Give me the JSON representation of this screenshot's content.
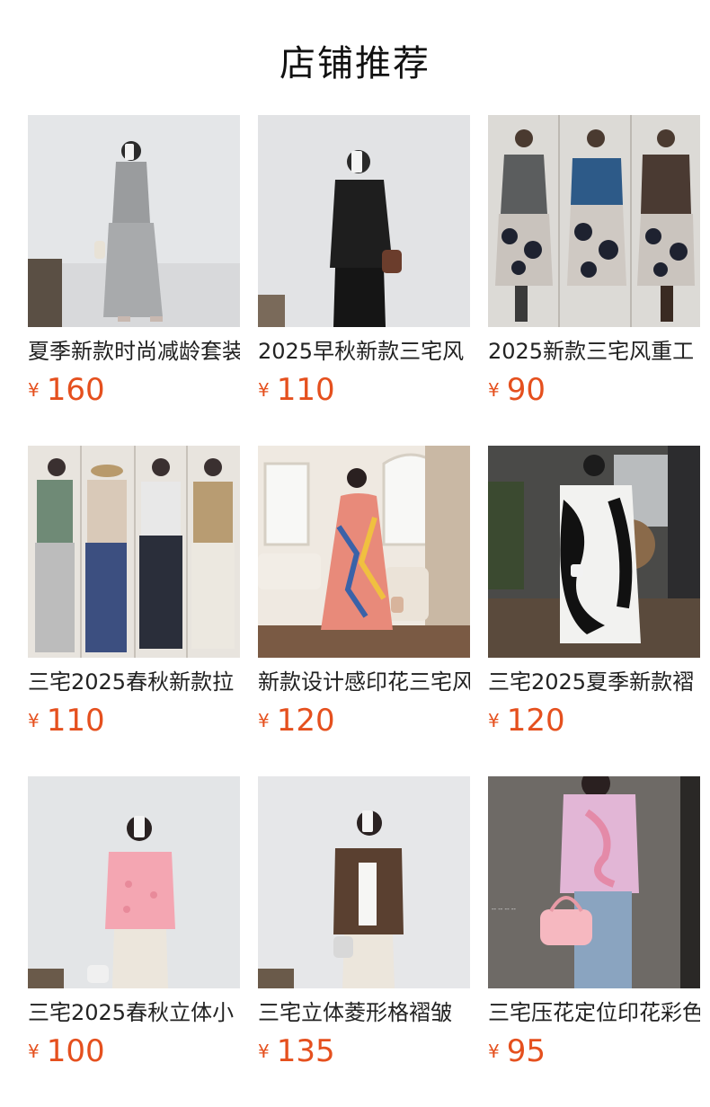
{
  "header": {
    "title": "店铺推荐"
  },
  "currency_symbol": "¥",
  "products": [
    {
      "name": "夏季新款时尚减龄套装",
      "price": "160"
    },
    {
      "name": "2025早秋新款三宅风",
      "price": "110"
    },
    {
      "name": "2025新款三宅风重工",
      "price": "90"
    },
    {
      "name": "三宅2025春秋新款拉",
      "price": "110"
    },
    {
      "name": "新款设计感印花三宅风",
      "price": "120"
    },
    {
      "name": "三宅2025夏季新款褶",
      "price": "120"
    },
    {
      "name": "三宅2025春秋立体小",
      "price": "100"
    },
    {
      "name": "三宅立体菱形格褶皱",
      "price": "135"
    },
    {
      "name": "三宅压花定位印花彩色",
      "price": "95"
    }
  ],
  "colors": {
    "price": "#e5501e",
    "title": "#111111"
  }
}
